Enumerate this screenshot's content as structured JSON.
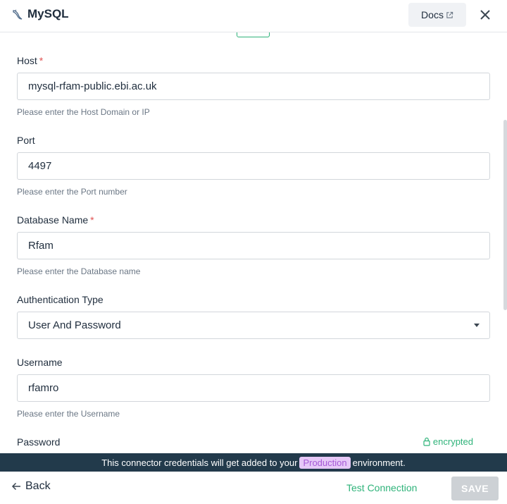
{
  "header": {
    "title": "MySQL",
    "docs_label": "Docs",
    "logo_icon": "mysql-dolphin-icon",
    "close_icon": "close-icon"
  },
  "form": {
    "host": {
      "label": "Host",
      "required_mark": "*",
      "value": "mysql-rfam-public.ebi.ac.uk",
      "hint": "Please enter the Host Domain or IP"
    },
    "port": {
      "label": "Port",
      "value": "4497",
      "hint": "Please enter the Port number"
    },
    "database": {
      "label": "Database Name",
      "required_mark": "*",
      "value": "Rfam",
      "hint": "Please enter the Database name"
    },
    "auth": {
      "label": "Authentication Type",
      "value": "User And Password"
    },
    "username": {
      "label": "Username",
      "value": "rfamro",
      "hint": "Please enter the Username"
    },
    "password": {
      "label": "Password",
      "encrypted_label": "encrypted"
    }
  },
  "banner": {
    "text_before": "This connector credentials will get added to your",
    "environment": "Production",
    "text_after": "environment."
  },
  "footer": {
    "back_label": "Back",
    "test_label": "Test Connection",
    "save_label": "SAVE"
  },
  "colors": {
    "accent_green": "#2fb37a",
    "banner_bg": "#223a4b",
    "env_pill_bg": "#e6c8f7",
    "env_pill_text": "#a65ad6",
    "required_red": "#e05252",
    "save_disabled": "#cdd1d5"
  }
}
